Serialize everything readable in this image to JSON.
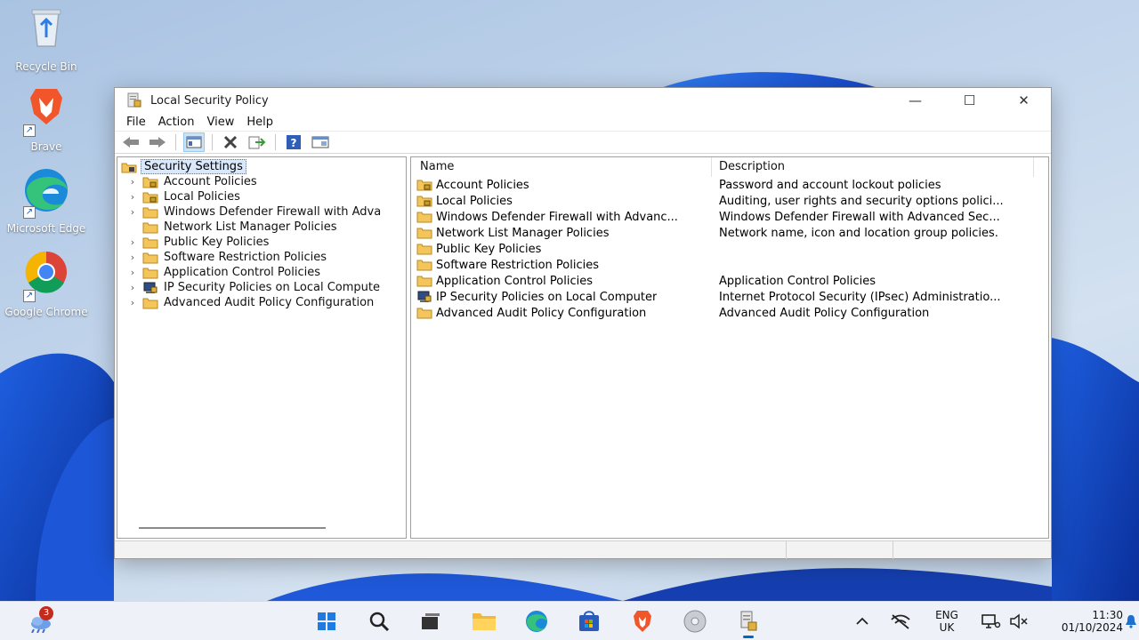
{
  "desktop": {
    "icons": [
      {
        "label": "Recycle Bin"
      },
      {
        "label": "Brave"
      },
      {
        "label": "Microsoft Edge"
      },
      {
        "label": "Google Chrome"
      }
    ]
  },
  "window": {
    "title": "Local Security Policy",
    "controls": {
      "minimize": "—",
      "maximize": "☐",
      "close": "✕"
    },
    "menu": [
      "File",
      "Action",
      "View",
      "Help"
    ],
    "toolbar": [
      "back-icon",
      "forward-icon",
      "show-hide-tree-icon",
      "delete-icon",
      "export-list-icon",
      "help-icon",
      "properties-icon"
    ]
  },
  "tree": {
    "root": "Security Settings",
    "items": [
      {
        "label": "Account Policies",
        "expandable": true,
        "icon": "lock-folder-icon"
      },
      {
        "label": "Local Policies",
        "expandable": true,
        "icon": "lock-folder-icon"
      },
      {
        "label": "Windows Defender Firewall with Adva",
        "expandable": true,
        "icon": "folder-icon"
      },
      {
        "label": "Network List Manager Policies",
        "expandable": false,
        "icon": "folder-icon"
      },
      {
        "label": "Public Key Policies",
        "expandable": true,
        "icon": "folder-icon"
      },
      {
        "label": "Software Restriction Policies",
        "expandable": true,
        "icon": "folder-icon"
      },
      {
        "label": "Application Control Policies",
        "expandable": true,
        "icon": "folder-icon"
      },
      {
        "label": "IP Security Policies on Local Compute",
        "expandable": true,
        "icon": "ipsec-computer-icon"
      },
      {
        "label": "Advanced Audit Policy Configuration",
        "expandable": true,
        "icon": "folder-icon"
      }
    ]
  },
  "list": {
    "columns": [
      "Name",
      "Description"
    ],
    "rows": [
      {
        "name": "Account Policies",
        "description": "Password and account lockout policies",
        "icon": "lock-folder-icon"
      },
      {
        "name": "Local Policies",
        "description": "Auditing, user rights and security options polici...",
        "icon": "lock-folder-icon"
      },
      {
        "name": "Windows Defender Firewall with Advanc...",
        "description": "Windows Defender Firewall with Advanced Sec...",
        "icon": "folder-icon"
      },
      {
        "name": "Network List Manager Policies",
        "description": "Network name, icon and location group policies.",
        "icon": "folder-icon"
      },
      {
        "name": "Public Key Policies",
        "description": "",
        "icon": "folder-icon"
      },
      {
        "name": "Software Restriction Policies",
        "description": "",
        "icon": "folder-icon"
      },
      {
        "name": "Application Control Policies",
        "description": "Application Control Policies",
        "icon": "folder-icon"
      },
      {
        "name": "IP Security Policies on Local Computer",
        "description": "Internet Protocol Security (IPsec) Administratio...",
        "icon": "ipsec-computer-icon"
      },
      {
        "name": "Advanced Audit Policy Configuration",
        "description": "Advanced Audit Policy Configuration",
        "icon": "folder-icon"
      }
    ]
  },
  "taskbar": {
    "weather_badge": "3",
    "apps": [
      "start-icon",
      "search-icon",
      "task-view-icon",
      "file-explorer-icon",
      "edge-icon",
      "store-icon",
      "brave-icon",
      "disc-icon",
      "local-security-policy-icon"
    ],
    "tray": {
      "lang_line1": "ENG",
      "lang_line2": "UK",
      "time": "11:30",
      "date": "01/10/2024"
    }
  },
  "colors": {
    "accent": "#0067c0",
    "folder": "#f3c55a",
    "selection": "#d9e8fb"
  }
}
